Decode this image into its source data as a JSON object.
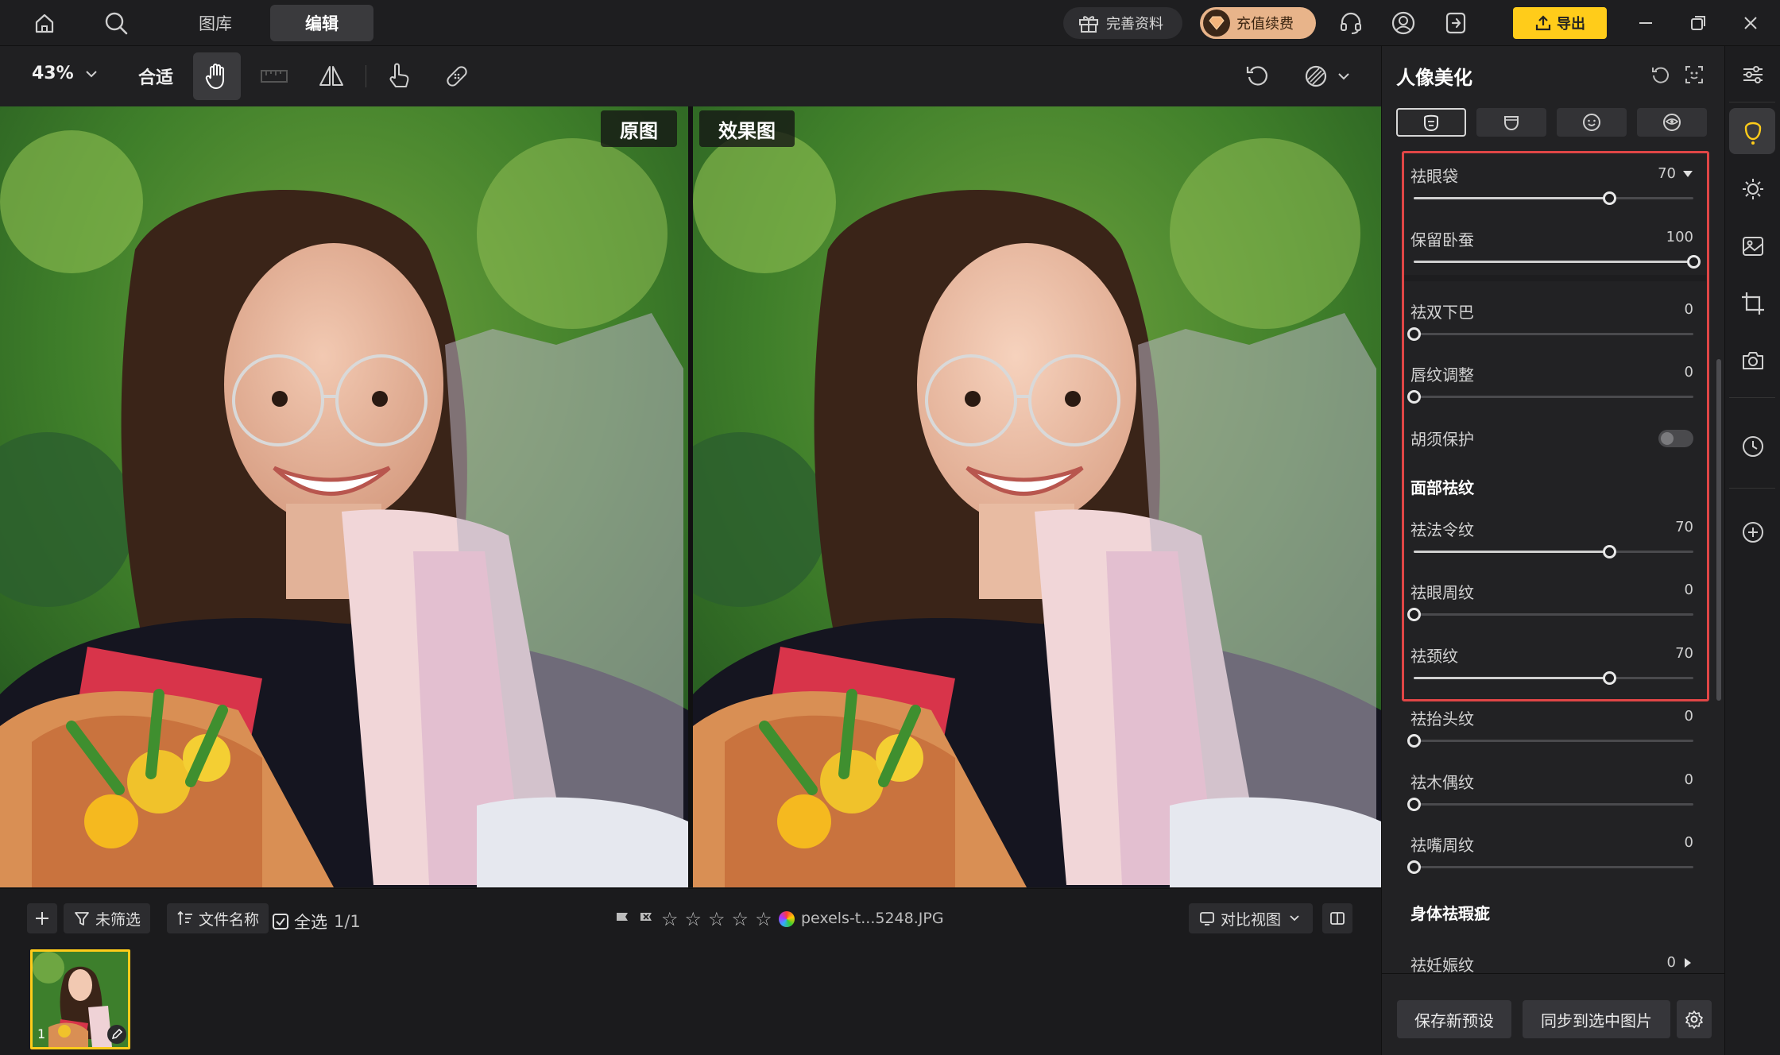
{
  "topbar": {
    "tabs": [
      {
        "label": "图库",
        "active": false
      },
      {
        "label": "编辑",
        "active": true
      }
    ],
    "complete_profile_label": "完善资料",
    "recharge_label": "充值续费",
    "export_label": "导出",
    "accent": "#ffcc1a"
  },
  "toolbar": {
    "zoom_value": "43%",
    "fit_label": "合适"
  },
  "viewer": {
    "original_label": "原图",
    "result_label": "效果图"
  },
  "bottombar": {
    "filter_label": "未筛选",
    "sort_label": "文件名称",
    "select_all_label": "全选",
    "count": "1/1",
    "filename": "pexels-t...5248.JPG",
    "compare_view_label": "对比视图",
    "thumb_index": "1"
  },
  "panel": {
    "title": "人像美化",
    "sliders_top": [
      {
        "label": "祛眼袋",
        "value": 70,
        "max": 100
      },
      {
        "label": "保留卧蚕",
        "value": 100,
        "max": 100
      },
      {
        "label": "祛双下巴",
        "value": 0,
        "max": 100
      },
      {
        "label": "唇纹调整",
        "value": 0,
        "max": 100
      }
    ],
    "beard_protect_label": "胡须保护",
    "beard_protect_on": false,
    "face_section_title": "面部祛纹",
    "face_sliders": [
      {
        "label": "祛法令纹",
        "value": 70,
        "max": 100
      },
      {
        "label": "祛眼周纹",
        "value": 0,
        "max": 100
      },
      {
        "label": "祛颈纹",
        "value": 70,
        "max": 100
      },
      {
        "label": "祛抬头纹",
        "value": 0,
        "max": 100
      },
      {
        "label": "祛木偶纹",
        "value": 0,
        "max": 100
      },
      {
        "label": "祛嘴周纹",
        "value": 0,
        "max": 100
      }
    ],
    "body_section_title": "身体祛瑕疵",
    "body_first_label": "祛妊娠纹",
    "body_first_value": "0",
    "save_preset_label": "保存新预设",
    "sync_label": "同步到选中图片",
    "highlight_color": "#e04646"
  }
}
